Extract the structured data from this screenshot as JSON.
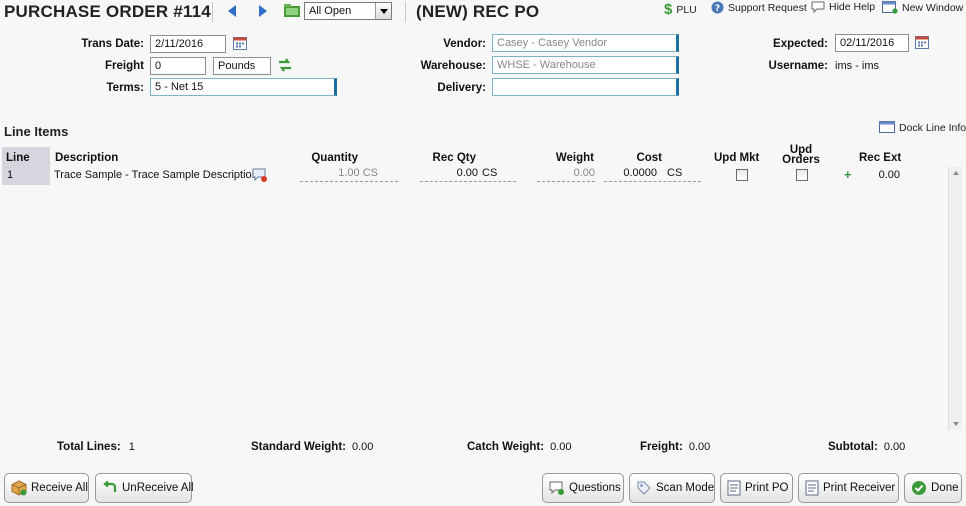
{
  "header": {
    "title": "PURCHASE ORDER #114",
    "filter": "All Open",
    "subtitle": "(NEW) REC PO",
    "links": {
      "plu": "PLU",
      "support": "Support Request",
      "hide_help": "Hide Help",
      "new_window": "New Window"
    }
  },
  "form": {
    "trans_date_label": "Trans Date:",
    "trans_date": "2/11/2016",
    "freight_label": "Freight",
    "freight": "0",
    "freight_unit": "Pounds",
    "terms_label": "Terms:",
    "terms": "5 - Net 15",
    "vendor_label": "Vendor:",
    "vendor": "Casey - Casey Vendor",
    "warehouse_label": "Warehouse:",
    "warehouse": "WHSE - Warehouse",
    "delivery_label": "Delivery:",
    "delivery": "",
    "expected_label": "Expected:",
    "expected": "02/11/2016",
    "username_label": "Username:",
    "username": "ims - ims"
  },
  "line_items": {
    "title": "Line Items",
    "dock_label": "Dock Line Info",
    "columns": {
      "line": "Line",
      "description": "Description",
      "quantity": "Quantity",
      "rec_qty": "Rec Qty",
      "weight": "Weight",
      "cost": "Cost",
      "upd_mkt": "Upd Mkt",
      "upd_orders": "Upd Orders",
      "rec_ext": "Rec Ext"
    },
    "rows": [
      {
        "line": "1",
        "description": "Trace Sample - Trace Sample Description",
        "quantity": "1.00 CS",
        "rec_qty": "0.00",
        "rec_qty_unit": "CS",
        "weight": "0.00",
        "cost": "0.0000",
        "cost_unit": "CS",
        "rec_ext": "0.00"
      }
    ]
  },
  "totals": {
    "total_lines_label": "Total Lines:",
    "total_lines": "1",
    "std_weight_label": "Standard Weight:",
    "std_weight": "0.00",
    "catch_weight_label": "Catch Weight:",
    "catch_weight": "0.00",
    "freight_label": "Freight:",
    "freight": "0.00",
    "subtotal_label": "Subtotal:",
    "subtotal": "0.00"
  },
  "buttons": {
    "receive_all": "Receive All",
    "unreceive_all": "UnReceive All",
    "questions": "Questions",
    "scan_mode": "Scan Mode",
    "print_po": "Print PO",
    "print_receiver": "Print Receiver",
    "done": "Done"
  },
  "icons": {
    "calendar": "calendar-icon",
    "swap": "swap-icon",
    "plu": "dollar-icon",
    "support": "help-icon",
    "hide_help": "speech-bubble-icon",
    "new_window": "window-icon",
    "dock": "window-icon",
    "note": "note-icon",
    "add": "plus-icon",
    "folder": "folder-icon"
  },
  "colors": {
    "accent": "#2f6fc8",
    "green": "#3a9a3a",
    "field_border": "#1f6f9f"
  }
}
